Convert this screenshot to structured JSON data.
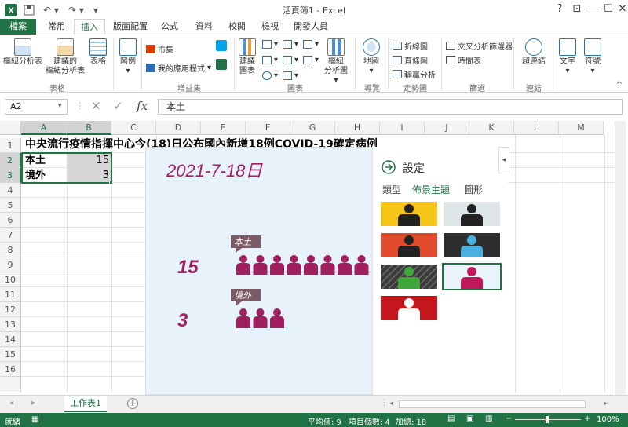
{
  "app": {
    "title": "活頁簿1 - Excel",
    "win_help": "?",
    "win_ribbon_opts": "⊡",
    "win_min": "—",
    "win_max": "☐",
    "win_close": "✕"
  },
  "tabs": [
    {
      "label": "檔案"
    },
    {
      "label": "常用"
    },
    {
      "label": "插入"
    },
    {
      "label": "版面配置"
    },
    {
      "label": "公式"
    },
    {
      "label": "資料"
    },
    {
      "label": "校閱"
    },
    {
      "label": "檢視"
    },
    {
      "label": "開發人員"
    }
  ],
  "ribbon": {
    "pivot": "樞紐分析表",
    "recommended_pivot_1": "建議的",
    "recommended_pivot_2": "樞紐分析表",
    "table": "表格",
    "illustrations": "圖例",
    "store": "市集",
    "my_apps": "我的應用程式",
    "recommended_charts_1": "建議",
    "recommended_charts_2": "圖表",
    "pivot_chart_1": "樞紐",
    "pivot_chart_2": "分析圖",
    "map": "地圖",
    "line": "折線圖",
    "column": "直條圖",
    "winloss": "輸贏分析",
    "slicer": "交叉分析篩選器",
    "timeline": "時間表",
    "hyperlink": "超連結",
    "text": "文字",
    "symbols": "符號",
    "groups": {
      "tables": "表格",
      "addins": "增益集",
      "charts": "圖表",
      "tours": "導覽",
      "sparklines": "走勢圖",
      "filters": "篩選",
      "links": "連結"
    }
  },
  "formula_bar": {
    "name_box": "A2",
    "content": "本土",
    "fx": "fx",
    "cancel": "✕",
    "enter": "✓"
  },
  "columns": [
    "A",
    "B",
    "C",
    "D",
    "E",
    "F",
    "G",
    "H",
    "I",
    "J",
    "K",
    "L",
    "M"
  ],
  "rows": [
    "1",
    "2",
    "3",
    "4",
    "5",
    "6",
    "7",
    "8",
    "9",
    "10",
    "11",
    "12",
    "13",
    "14",
    "15",
    "16"
  ],
  "cells": {
    "a1": "中央流行疫情指揮中心今(18)日公布國內新增18例COVID-19確定病例",
    "a2": "本土",
    "b2": "15",
    "a3": "境外",
    "b3": "3"
  },
  "chart_data": {
    "type": "pictograph",
    "title": "2021-7-18日",
    "categories": [
      "本土",
      "境外"
    ],
    "values": [
      15,
      3
    ],
    "icon_color": "#a01f5f"
  },
  "settings_pane": {
    "title": "設定",
    "tab_type": "類型",
    "tab_theme": "佈景主題",
    "tab_shape": "圖形",
    "themes": [
      {
        "bg": "#f5c518",
        "fg": "#222222"
      },
      {
        "bg": "#dfe6e8",
        "fg": "#222222"
      },
      {
        "bg": "#e24b2e",
        "fg": "#222222"
      },
      {
        "bg": "#2e2e2e",
        "fg": "#49b0e0"
      },
      {
        "bg": "#3a3a3a",
        "fg": "#3fa63a",
        "striped": true
      },
      {
        "bg": "#e9f3fb",
        "fg": "#c2185b",
        "selected": true
      },
      {
        "bg": "#c5161d",
        "fg": "#ffffff"
      }
    ]
  },
  "sheet": {
    "active_tab": "工作表1",
    "add": "+"
  },
  "status": {
    "ready": "就緒",
    "average": "平均值: 9",
    "count": "項目個數: 4",
    "sum": "加總: 18",
    "zoom": "100%"
  }
}
